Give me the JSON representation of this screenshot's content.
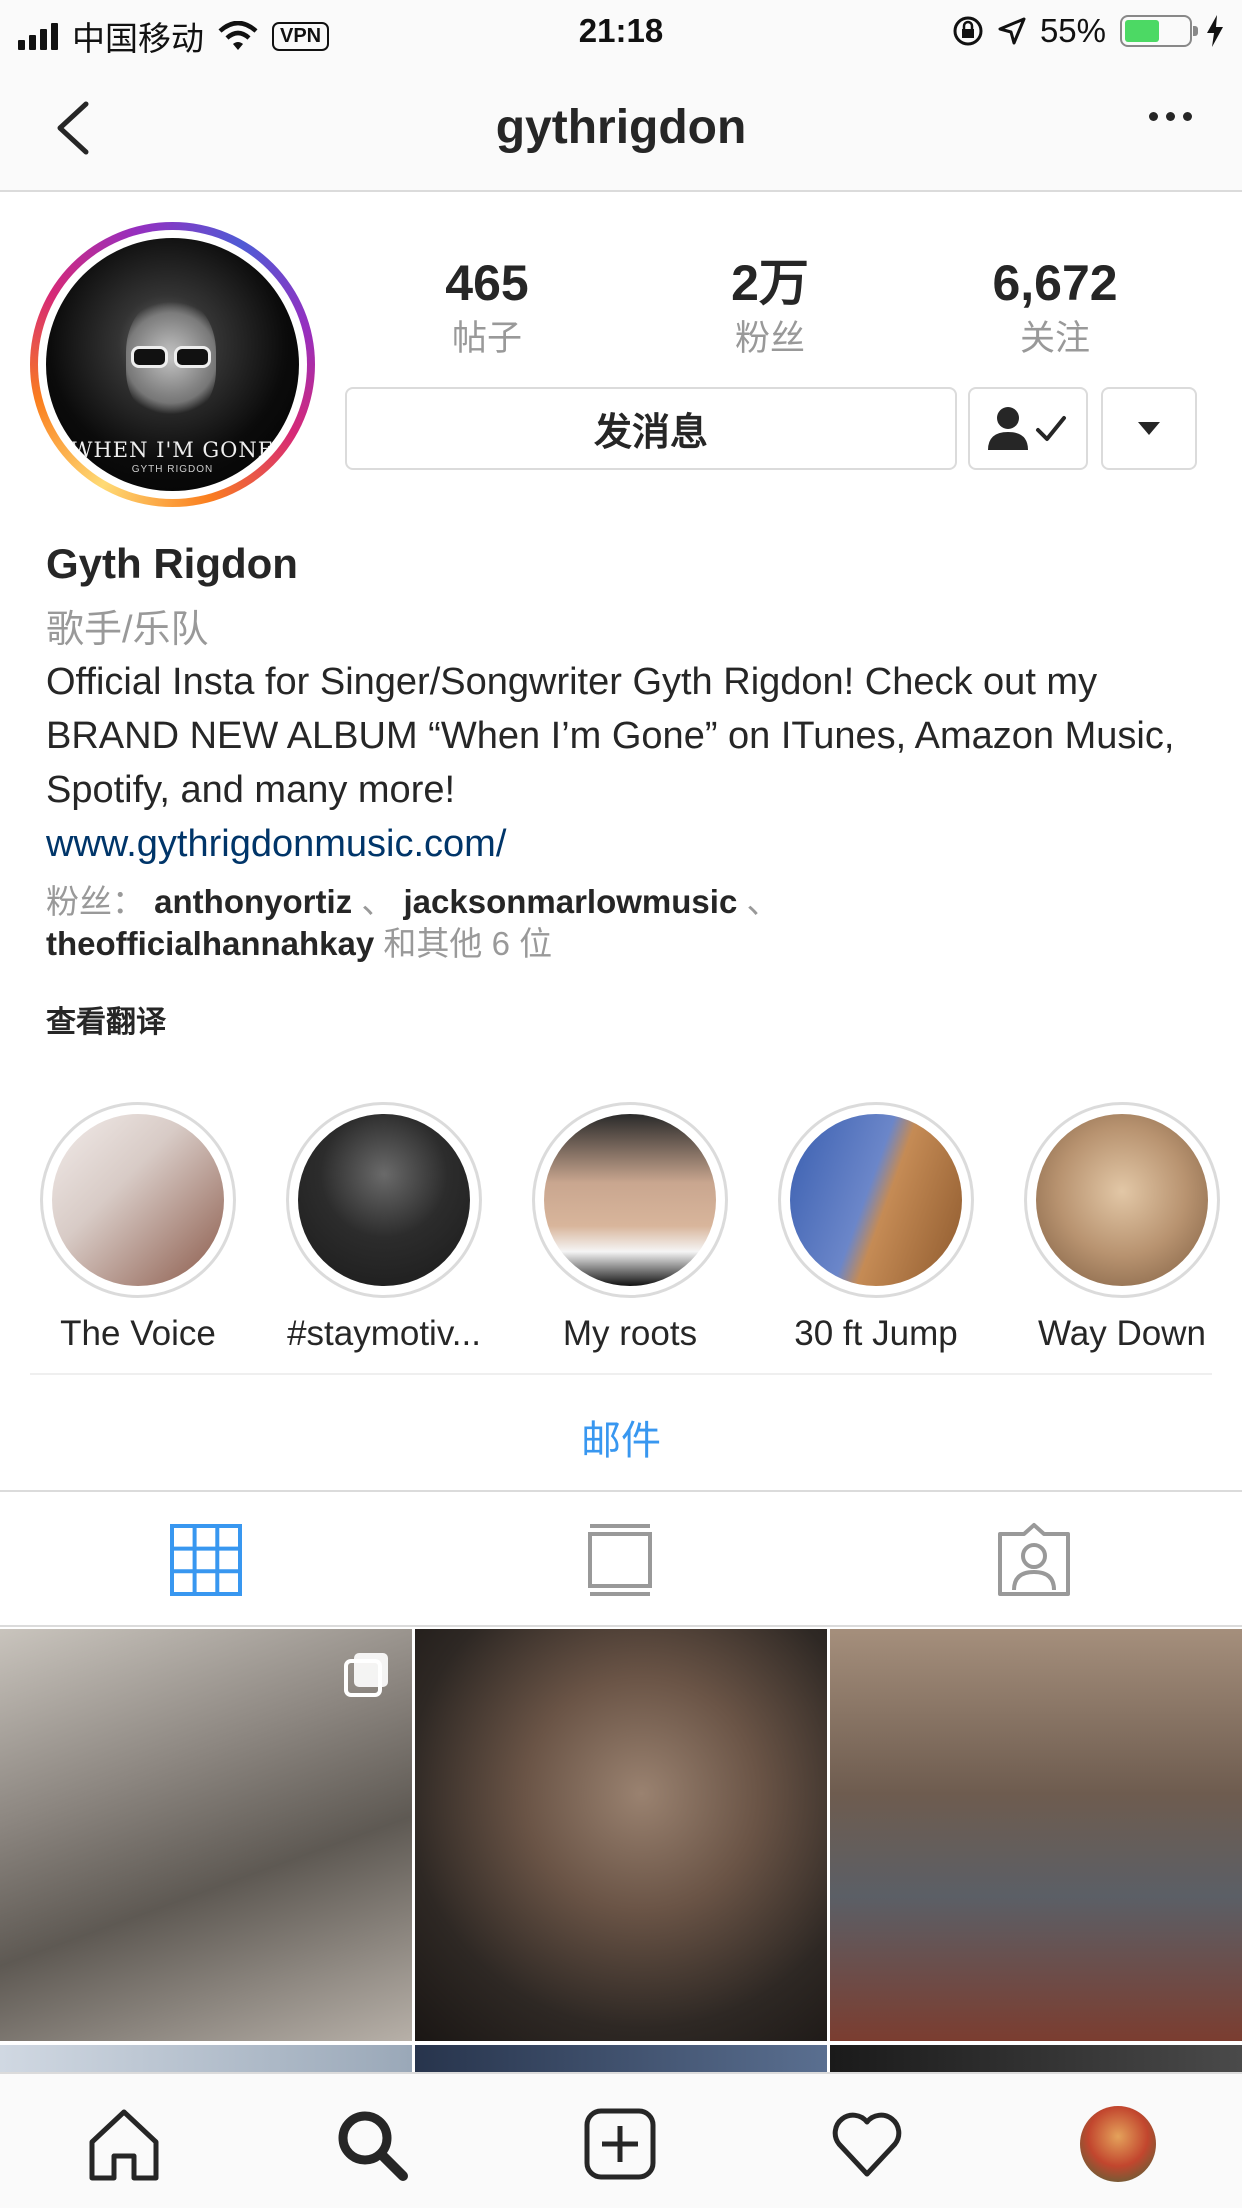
{
  "status_bar": {
    "carrier": "中国移动",
    "vpn": "VPN",
    "time": "21:18",
    "battery": "55%",
    "battery_level": 0.55
  },
  "nav": {
    "title": "gythrigdon",
    "back_icon": "chevron-left-icon",
    "more_icon": "more-horizontal-icon"
  },
  "profile": {
    "avatar": {
      "text": "WHEN I'M GONE",
      "subtext": "GYTH RIGDON"
    },
    "stats": [
      {
        "value": "465",
        "label": "帖子"
      },
      {
        "value": "2万",
        "label": "粉丝"
      },
      {
        "value": "6,672",
        "label": "关注"
      }
    ],
    "message_button": "发消息",
    "following_icon": "person-check-icon",
    "dropdown_icon": "triangle-down-icon",
    "name": "Gyth Rigdon",
    "category": "歌手/乐队",
    "bio": "Official Insta for Singer/Songwriter Gyth Rigdon! Check out my BRAND NEW ALBUM “When I’m Gone” on ITunes, Amazon Music, Spotify, and many more!",
    "link": "www.gythrigdonmusic.com/",
    "followed_by": {
      "prefix": "粉丝：",
      "user1": "anthonyortiz",
      "sep1": "、",
      "user2": "jacksonmarlowmusic",
      "sep2": "、",
      "user3": "theofficialhannahkay",
      "suffix": "和其他 6 位"
    },
    "translate": "查看翻译"
  },
  "highlights": [
    {
      "label": "The Voice"
    },
    {
      "label": "#staymotiv..."
    },
    {
      "label": "My roots"
    },
    {
      "label": "30 ft Jump"
    },
    {
      "label": "Way Down"
    }
  ],
  "email_label": "邮件",
  "tabs": [
    {
      "name": "grid-icon",
      "active": true
    },
    {
      "name": "feed-icon",
      "active": false
    },
    {
      "name": "tagged-icon",
      "active": false
    }
  ],
  "tab_bar": [
    {
      "name": "home-icon"
    },
    {
      "name": "search-icon"
    },
    {
      "name": "add-post-icon"
    },
    {
      "name": "heart-icon"
    },
    {
      "name": "profile-avatar-icon"
    }
  ],
  "colors": {
    "accent": "#3897f0",
    "link": "#003569",
    "muted": "#999999",
    "border": "#dbdbdb"
  }
}
